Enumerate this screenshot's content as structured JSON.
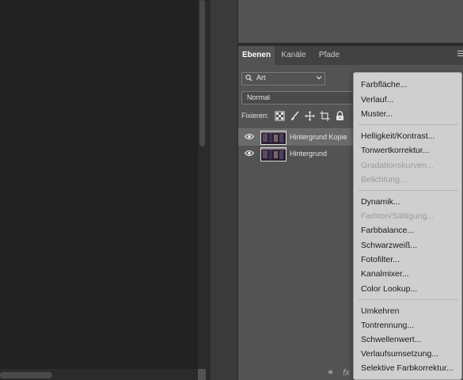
{
  "panel": {
    "tabs": [
      {
        "label": "Ebenen"
      },
      {
        "label": "Kanäle"
      },
      {
        "label": "Pfade"
      }
    ],
    "filter": {
      "label": "Art"
    },
    "blend_mode": "Normal",
    "lock_label": "Fixieren:",
    "layers": [
      {
        "name": "Hintergrund Kopie",
        "selected": true
      },
      {
        "name": "Hintergrund",
        "selected": false
      }
    ],
    "bottom_icons": [
      "link-layers-icon",
      "fx-icon"
    ],
    "bottom_fx": "fx"
  },
  "adjust_menu": {
    "items": [
      {
        "label": "Farbfläche...",
        "disabled": false
      },
      {
        "label": "Verlauf...",
        "disabled": false
      },
      {
        "label": "Muster...",
        "disabled": false
      },
      {
        "label": "Helligkeit/Kontrast...",
        "disabled": false
      },
      {
        "label": "Tonwertkorrektur...",
        "disabled": false
      },
      {
        "label": "Gradationskurven...",
        "disabled": true
      },
      {
        "label": "Belichtung...",
        "disabled": true
      },
      {
        "label": "Dynamik...",
        "disabled": false
      },
      {
        "label": "Farbton/Sättigung...",
        "disabled": true
      },
      {
        "label": "Farbbalance...",
        "disabled": false
      },
      {
        "label": "Schwarzweiß...",
        "disabled": false
      },
      {
        "label": "Fotofilter...",
        "disabled": false
      },
      {
        "label": "Kanalmixer...",
        "disabled": false
      },
      {
        "label": "Color Lookup...",
        "disabled": false
      },
      {
        "label": "Umkehren",
        "disabled": false
      },
      {
        "label": "Tontrennung...",
        "disabled": false
      },
      {
        "label": "Schwellenwert...",
        "disabled": false
      },
      {
        "label": "Verlaufsumsetzung...",
        "disabled": false
      },
      {
        "label": "Selektive Farbkorrektur...",
        "disabled": false
      }
    ]
  },
  "colors": {
    "canvas": "#222222",
    "panel": "#535353",
    "menu_bg": "#cfcfcf",
    "menu_disabled": "#9a9a9a"
  }
}
